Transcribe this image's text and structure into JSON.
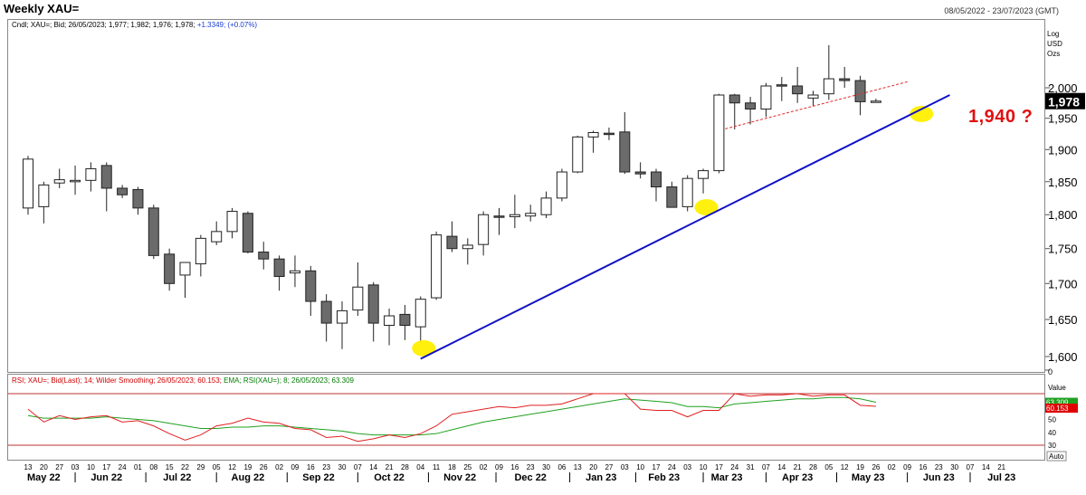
{
  "header": {
    "title": "Weekly XAU=",
    "date_range": "08/05/2022 - 23/07/2023 (GMT)"
  },
  "price_legend": {
    "text": "Cndl; XAU=; Bid; 26/05/2023; 1,977; 1,982; 1,976; 1,978;",
    "change": "+1.3349; (+0.07%)"
  },
  "scale_info": [
    "Log",
    "USD",
    "Ozs"
  ],
  "rsi_legend": {
    "rsi_text": "RSI; XAU=; Bid(Last); 14; Wilder Smoothing; 26/05/2023; 60.153;",
    "ema_text": "EMA; RSI(XAU=); 8; 26/05/2023; 63.309"
  },
  "annotation": "1,940 ?",
  "chart_data": {
    "type": "candlestick",
    "title": "Weekly XAU=",
    "scale": "log",
    "ylim": [
      1580,
      2080
    ],
    "y_ticks": [
      {
        "label": "2,000",
        "v": 2000
      },
      {
        "label": "1,950",
        "v": 1950
      },
      {
        "label": "1,900",
        "v": 1900
      },
      {
        "label": "1,850",
        "v": 1850
      },
      {
        "label": "1,800",
        "v": 1800
      },
      {
        "label": "1,750",
        "v": 1750
      },
      {
        "label": "1,700",
        "v": 1700
      },
      {
        "label": "1,650",
        "v": 1650
      },
      {
        "label": "1,600",
        "v": 1600
      },
      {
        "label": "0",
        "v": 1567
      }
    ],
    "last_price": {
      "label": "1,978",
      "v": 1978
    },
    "candles": [
      {
        "o": 1810,
        "h": 1890,
        "l": 1800,
        "c": 1885
      },
      {
        "o": 1812,
        "h": 1850,
        "l": 1787,
        "c": 1845
      },
      {
        "o": 1848,
        "h": 1870,
        "l": 1840,
        "c": 1853
      },
      {
        "o": 1850,
        "h": 1875,
        "l": 1830,
        "c": 1852
      },
      {
        "o": 1852,
        "h": 1880,
        "l": 1835,
        "c": 1870
      },
      {
        "o": 1875,
        "h": 1880,
        "l": 1805,
        "c": 1840
      },
      {
        "o": 1840,
        "h": 1845,
        "l": 1825,
        "c": 1830
      },
      {
        "o": 1838,
        "h": 1842,
        "l": 1800,
        "c": 1810
      },
      {
        "o": 1810,
        "h": 1815,
        "l": 1735,
        "c": 1740
      },
      {
        "o": 1742,
        "h": 1750,
        "l": 1690,
        "c": 1700
      },
      {
        "o": 1712,
        "h": 1730,
        "l": 1680,
        "c": 1730
      },
      {
        "o": 1728,
        "h": 1770,
        "l": 1710,
        "c": 1765
      },
      {
        "o": 1760,
        "h": 1790,
        "l": 1755,
        "c": 1775
      },
      {
        "o": 1775,
        "h": 1810,
        "l": 1765,
        "c": 1805
      },
      {
        "o": 1802,
        "h": 1805,
        "l": 1743,
        "c": 1745
      },
      {
        "o": 1745,
        "h": 1760,
        "l": 1720,
        "c": 1735
      },
      {
        "o": 1735,
        "h": 1740,
        "l": 1690,
        "c": 1710
      },
      {
        "o": 1715,
        "h": 1740,
        "l": 1695,
        "c": 1718
      },
      {
        "o": 1718,
        "h": 1725,
        "l": 1655,
        "c": 1675
      },
      {
        "o": 1675,
        "h": 1685,
        "l": 1620,
        "c": 1645
      },
      {
        "o": 1645,
        "h": 1675,
        "l": 1610,
        "c": 1662
      },
      {
        "o": 1663,
        "h": 1730,
        "l": 1655,
        "c": 1695
      },
      {
        "o": 1698,
        "h": 1702,
        "l": 1620,
        "c": 1645
      },
      {
        "o": 1642,
        "h": 1665,
        "l": 1615,
        "c": 1655
      },
      {
        "o": 1657,
        "h": 1670,
        "l": 1622,
        "c": 1642
      },
      {
        "o": 1640,
        "h": 1682,
        "l": 1618,
        "c": 1678
      },
      {
        "o": 1680,
        "h": 1775,
        "l": 1677,
        "c": 1770
      },
      {
        "o": 1768,
        "h": 1790,
        "l": 1745,
        "c": 1750
      },
      {
        "o": 1750,
        "h": 1765,
        "l": 1727,
        "c": 1755
      },
      {
        "o": 1756,
        "h": 1805,
        "l": 1740,
        "c": 1800
      },
      {
        "o": 1798,
        "h": 1810,
        "l": 1770,
        "c": 1797
      },
      {
        "o": 1797,
        "h": 1830,
        "l": 1780,
        "c": 1800
      },
      {
        "o": 1798,
        "h": 1815,
        "l": 1790,
        "c": 1802
      },
      {
        "o": 1800,
        "h": 1835,
        "l": 1795,
        "c": 1825
      },
      {
        "o": 1825,
        "h": 1870,
        "l": 1820,
        "c": 1865
      },
      {
        "o": 1865,
        "h": 1922,
        "l": 1863,
        "c": 1920
      },
      {
        "o": 1920,
        "h": 1930,
        "l": 1895,
        "c": 1927
      },
      {
        "o": 1926,
        "h": 1935,
        "l": 1915,
        "c": 1925
      },
      {
        "o": 1928,
        "h": 1960,
        "l": 1862,
        "c": 1865
      },
      {
        "o": 1865,
        "h": 1880,
        "l": 1855,
        "c": 1862
      },
      {
        "o": 1865,
        "h": 1870,
        "l": 1820,
        "c": 1842
      },
      {
        "o": 1842,
        "h": 1850,
        "l": 1815,
        "c": 1811
      },
      {
        "o": 1812,
        "h": 1860,
        "l": 1805,
        "c": 1855
      },
      {
        "o": 1855,
        "h": 1870,
        "l": 1832,
        "c": 1867
      },
      {
        "o": 1867,
        "h": 1990,
        "l": 1863,
        "c": 1988
      },
      {
        "o": 1988,
        "h": 1990,
        "l": 1932,
        "c": 1975
      },
      {
        "o": 1975,
        "h": 1985,
        "l": 1940,
        "c": 1965
      },
      {
        "o": 1965,
        "h": 2008,
        "l": 1952,
        "c": 2003
      },
      {
        "o": 2005,
        "h": 2018,
        "l": 1978,
        "c": 2004
      },
      {
        "o": 2003,
        "h": 2035,
        "l": 1975,
        "c": 1990
      },
      {
        "o": 1983,
        "h": 1995,
        "l": 1970,
        "c": 1988
      },
      {
        "o": 1990,
        "h": 2072,
        "l": 1980,
        "c": 2015
      },
      {
        "o": 2015,
        "h": 2035,
        "l": 2000,
        "c": 2012
      },
      {
        "o": 2012,
        "h": 2020,
        "l": 1955,
        "c": 1977
      },
      {
        "o": 1977,
        "h": 1982,
        "l": 1976,
        "c": 1978
      }
    ],
    "support_line": {
      "start": {
        "index": 25,
        "v": 1597
      },
      "end": {
        "index": 58.7,
        "v": 1988
      }
    },
    "resistance_line": {
      "start": {
        "index": 44.4,
        "v": 1933
      },
      "end": {
        "index": 56,
        "v": 2010
      }
    },
    "highlights": [
      {
        "index": 25.2,
        "v": 1611
      },
      {
        "index": 43.2,
        "v": 1811
      },
      {
        "index": 56.9,
        "v": 1957
      }
    ],
    "x_weeks": [
      "13",
      "20",
      "27",
      "03",
      "10",
      "17",
      "24",
      "01",
      "08",
      "15",
      "22",
      "29",
      "05",
      "12",
      "19",
      "26",
      "02",
      "09",
      "16",
      "23",
      "30",
      "07",
      "14",
      "21",
      "28",
      "04",
      "11",
      "18",
      "25",
      "02",
      "09",
      "16",
      "23",
      "30",
      "06",
      "13",
      "20",
      "27",
      "03",
      "10",
      "17",
      "24",
      "03",
      "10",
      "17",
      "24",
      "31",
      "07",
      "14",
      "21",
      "28",
      "05",
      "12",
      "19",
      "26",
      "02",
      "09",
      "16",
      "23",
      "30",
      "07",
      "14",
      "21"
    ],
    "x_months": [
      {
        "label": "May 22",
        "at": 1
      },
      {
        "label": "Jun 22",
        "at": 5
      },
      {
        "label": "Jul 22",
        "at": 9.5
      },
      {
        "label": "Aug 22",
        "at": 14
      },
      {
        "label": "Sep 22",
        "at": 18.5
      },
      {
        "label": "Oct 22",
        "at": 23
      },
      {
        "label": "Nov 22",
        "at": 27.5
      },
      {
        "label": "Dec 22",
        "at": 32
      },
      {
        "label": "Jan 23",
        "at": 36.5
      },
      {
        "label": "Feb 23",
        "at": 40.5
      },
      {
        "label": "Mar 23",
        "at": 44.5
      },
      {
        "label": "Apr 23",
        "at": 49
      },
      {
        "label": "May 23",
        "at": 53.5
      },
      {
        "label": "Jun 23",
        "at": 58
      },
      {
        "label": "Jul 23",
        "at": 62
      }
    ],
    "rsi": {
      "name": "RSI",
      "ylim": [
        24,
        78
      ],
      "upper_band": 70,
      "lower_band": 30,
      "ticks": [
        {
          "label": "Value",
          "v": 75
        },
        {
          "label": "50",
          "v": 50
        },
        {
          "label": "40",
          "v": 40
        },
        {
          "label": "30",
          "v": 30
        }
      ],
      "last_value": {
        "label": "60.153",
        "v": 60.153
      },
      "values": [
        58,
        48,
        53,
        50,
        52,
        53,
        48,
        49,
        45,
        39,
        34,
        38,
        45,
        47,
        51,
        48,
        47,
        43,
        42,
        36,
        37,
        33,
        35,
        38,
        36,
        39,
        45,
        54,
        56,
        58,
        60,
        59,
        61,
        61,
        62,
        66,
        70,
        70,
        70,
        58,
        57,
        57,
        52,
        57,
        57,
        70,
        68,
        69,
        69,
        70,
        68,
        69,
        69,
        61,
        60.153
      ]
    },
    "ema": {
      "name": "EMA",
      "last_value": {
        "label": "63.309",
        "v": 63.309
      },
      "values": [
        53,
        51,
        51,
        51,
        51,
        52,
        51,
        50,
        49,
        47,
        45,
        43,
        43,
        44,
        44,
        45,
        45,
        44,
        43,
        42,
        41,
        39,
        38,
        38,
        38,
        38,
        39,
        42,
        45,
        48,
        50,
        52,
        54,
        56,
        58,
        60,
        62,
        64,
        66,
        65,
        64,
        63,
        60,
        60,
        59,
        62,
        63,
        64,
        65,
        66,
        66,
        67,
        67,
        66,
        63.309
      ]
    }
  },
  "colors": {
    "bull_body": "#ffffff",
    "bear_body": "#6b6b6b",
    "support_line": "#1010c8",
    "resistance_line": "#e03030",
    "highlight": "#ffef00",
    "rsi_line": "#e02020",
    "ema_line": "#20a020",
    "band_line": "#c03030"
  },
  "footer_label": "Auto"
}
